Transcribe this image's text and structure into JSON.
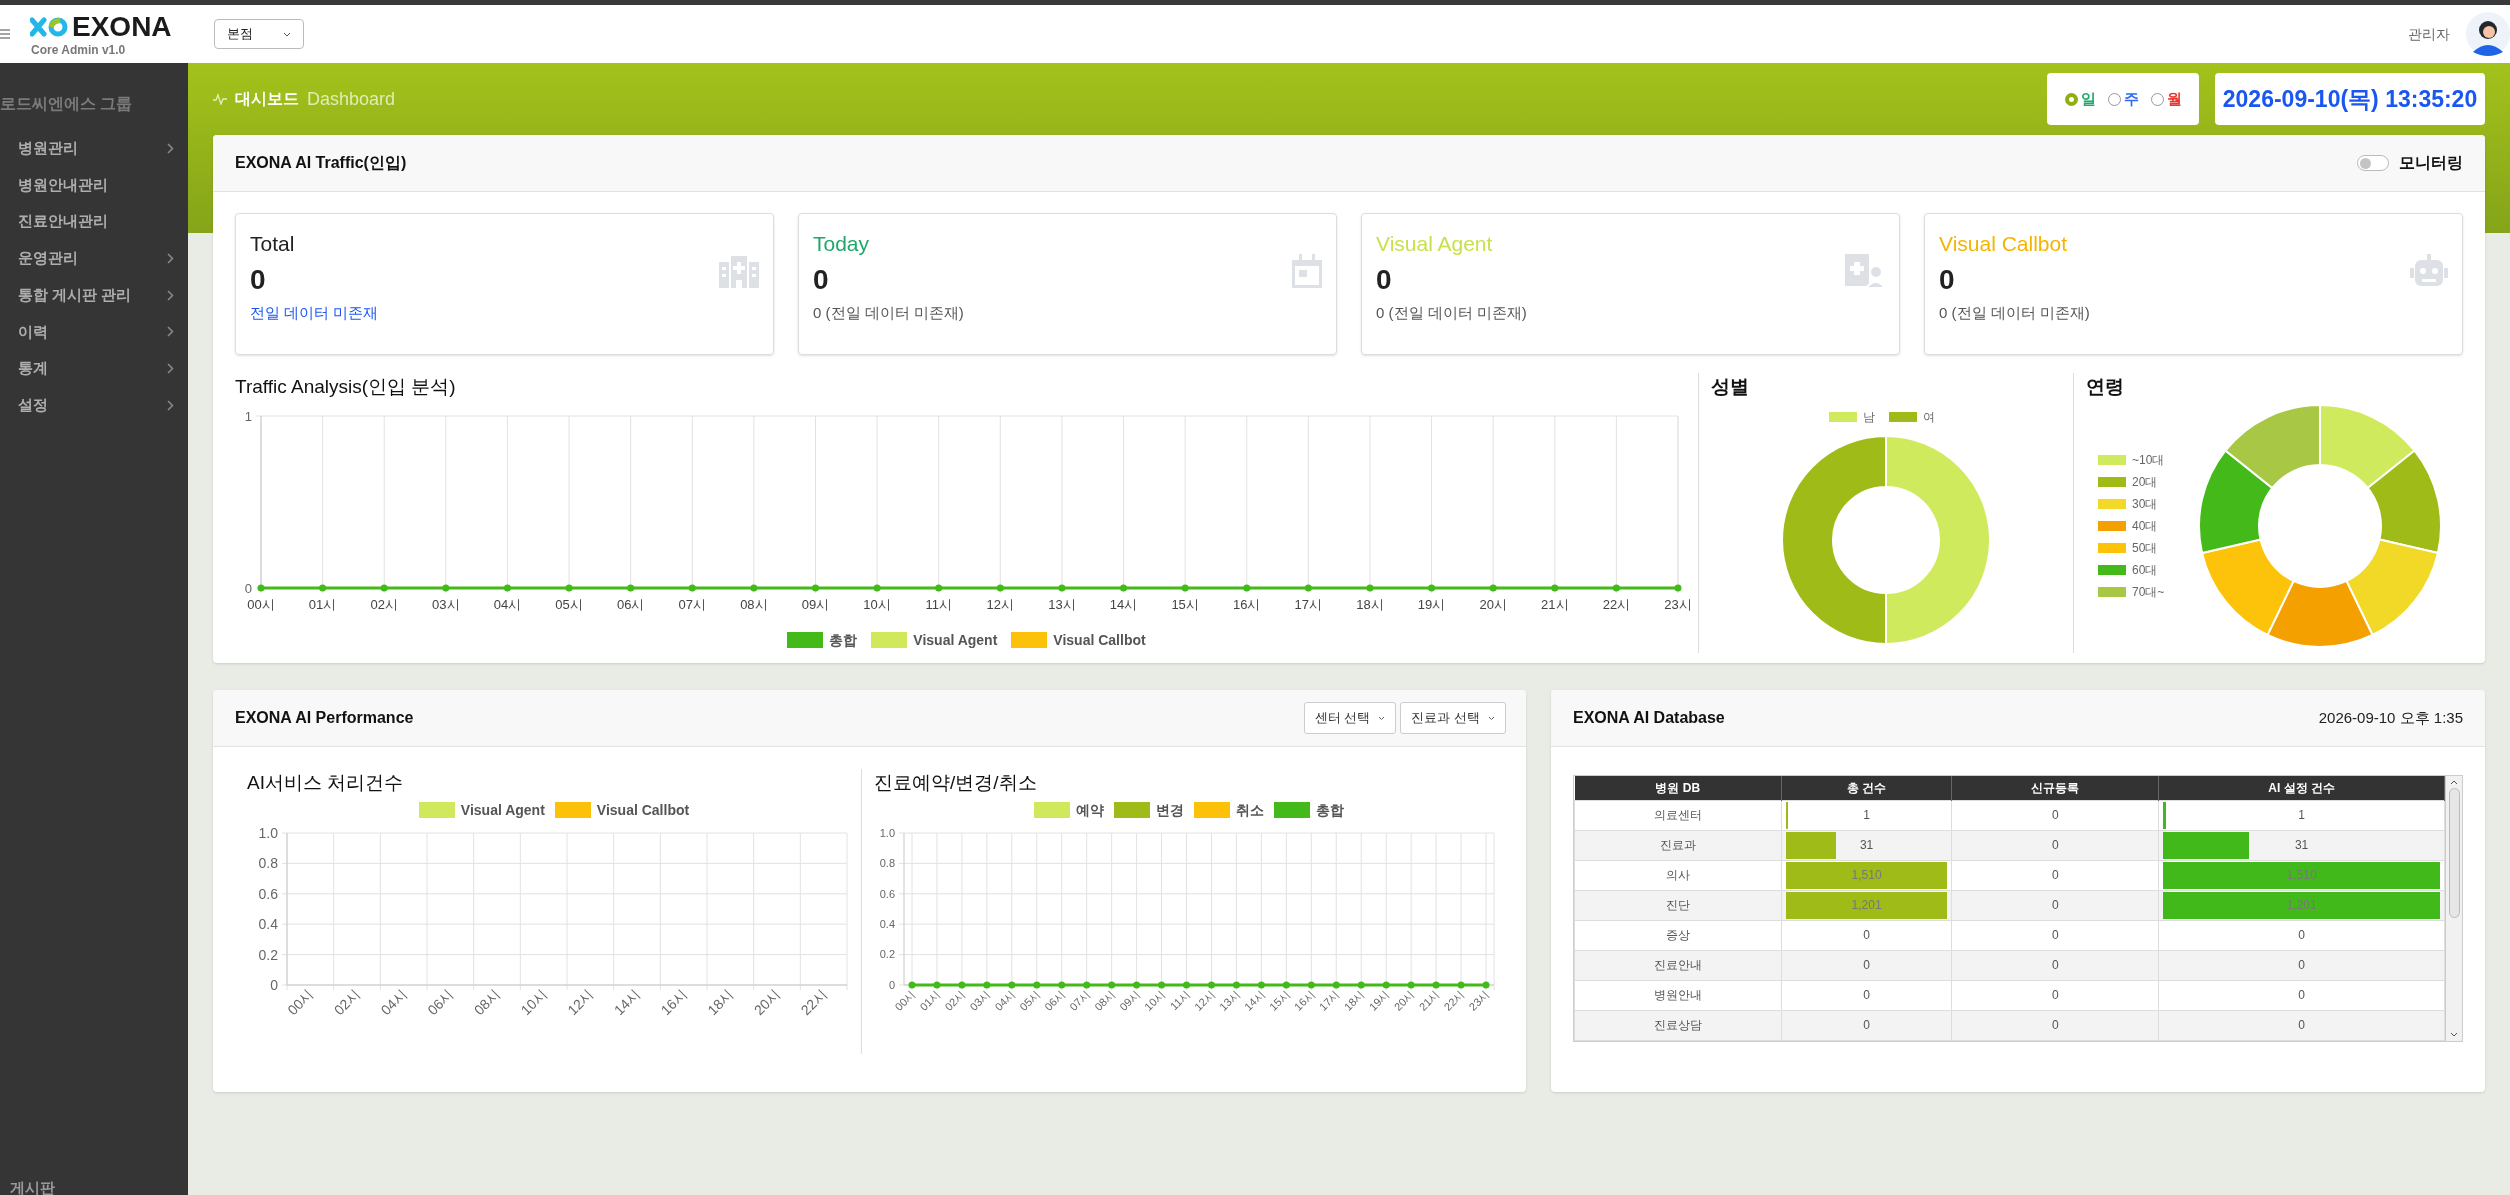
{
  "header": {
    "logo_text": "EXONA",
    "logo_subtitle": "Core Admin v1.0",
    "branch_select": "본점",
    "user_name": "관리자"
  },
  "sidebar": {
    "group_title": "로드씨엔에스 그룹",
    "items": [
      {
        "label": "병원관리",
        "expandable": true
      },
      {
        "label": "병원안내관리",
        "expandable": false
      },
      {
        "label": "진료안내관리",
        "expandable": false
      },
      {
        "label": "운영관리",
        "expandable": true
      },
      {
        "label": "통합 게시판 관리",
        "expandable": true
      },
      {
        "label": "이력",
        "expandable": true
      },
      {
        "label": "통계",
        "expandable": true
      },
      {
        "label": "설정",
        "expandable": true
      }
    ],
    "footer_item": "게시판"
  },
  "breadcrumb": {
    "title": "대시보드",
    "subtitle": "Dashboard"
  },
  "period_options": [
    {
      "label": "일",
      "selected": true,
      "color": "#1ea86a"
    },
    {
      "label": "주",
      "selected": false,
      "color": "#2f6bf5"
    },
    {
      "label": "월",
      "selected": false,
      "color": "#e8382f"
    }
  ],
  "clock": "2026-09-10(목) 13:35:20",
  "traffic_card": {
    "title": "EXONA AI Traffic(인입)",
    "monitoring": {
      "label": "모니터링",
      "on": false
    },
    "stats": [
      {
        "kind": "total",
        "title": "Total",
        "color": "#222222",
        "value": "0",
        "note": "전일 데이터 미존재"
      },
      {
        "kind": "today",
        "title": "Today",
        "color": "#1ea86a",
        "value": "0",
        "note": "0 (전일 데이터 미존재)"
      },
      {
        "kind": "agent",
        "title": "Visual Agent",
        "color": "#c9e04c",
        "value": "0",
        "note": "0 (전일 데이터 미존재)"
      },
      {
        "kind": "callbot",
        "title": "Visual Callbot",
        "color": "#f5b400",
        "value": "0",
        "note": "0 (전일 데이터 미존재)"
      }
    ],
    "traffic_analysis": {
      "title": "Traffic Analysis(인입 분석)",
      "chart_data": {
        "type": "line",
        "categories": [
          "00시",
          "01시",
          "02시",
          "03시",
          "04시",
          "05시",
          "06시",
          "07시",
          "08시",
          "09시",
          "10시",
          "11시",
          "12시",
          "13시",
          "14시",
          "15시",
          "16시",
          "17시",
          "18시",
          "19시",
          "20시",
          "21시",
          "22시",
          "23시"
        ],
        "ylim": [
          0,
          1
        ],
        "yticks": [
          0,
          1
        ],
        "grid": true,
        "series": [
          {
            "name": "총합",
            "color": "#43b91a",
            "marker": true,
            "values": [
              0,
              0,
              0,
              0,
              0,
              0,
              0,
              0,
              0,
              0,
              0,
              0,
              0,
              0,
              0,
              0,
              0,
              0,
              0,
              0,
              0,
              0,
              0,
              0
            ]
          },
          {
            "name": "Visual Agent",
            "color": "#d0e85c",
            "values": [
              null,
              null,
              null,
              null,
              null,
              null,
              null,
              null,
              null,
              null,
              null,
              null,
              null,
              null,
              null,
              null,
              null,
              null,
              null,
              null,
              null,
              null,
              null,
              null
            ]
          },
          {
            "name": "Visual Callbot",
            "color": "#fcc20a",
            "values": [
              null,
              null,
              null,
              null,
              null,
              null,
              null,
              null,
              null,
              null,
              null,
              null,
              null,
              null,
              null,
              null,
              null,
              null,
              null,
              null,
              null,
              null,
              null,
              null
            ]
          }
        ]
      }
    },
    "gender": {
      "title": "성별",
      "legend": [
        {
          "label": "남",
          "color": "#d0ea5e"
        },
        {
          "label": "여",
          "color": "#9fbb17"
        }
      ]
    },
    "age": {
      "title": "연령",
      "legend": [
        {
          "label": "~10대",
          "color": "#d0ea5e"
        },
        {
          "label": "20대",
          "color": "#9fbb17"
        },
        {
          "label": "30대",
          "color": "#f3d927"
        },
        {
          "label": "40대",
          "color": "#f4a000"
        },
        {
          "label": "50대",
          "color": "#fdc30a"
        },
        {
          "label": "60대",
          "color": "#43b91a"
        },
        {
          "label": "70대~",
          "color": "#a8c845"
        }
      ]
    }
  },
  "performance_card": {
    "title": "EXONA AI Performance",
    "filters": [
      "센터 선택",
      "진료과 선택"
    ],
    "service_chart": {
      "title": "AI서비스 처리건수",
      "chart_data": {
        "type": "bar",
        "categories": [
          "00시",
          "02시",
          "04시",
          "06시",
          "08시",
          "10시",
          "12시",
          "14시",
          "16시",
          "18시",
          "20시",
          "22시"
        ],
        "ylim": [
          0,
          1
        ],
        "yticks": [
          0,
          0.2,
          0.4,
          0.6,
          0.8,
          {
            "value": 1,
            "label": "1.0"
          }
        ],
        "grid": true,
        "series": [
          {
            "name": "Visual Agent",
            "color": "#d0e85c",
            "values": [
              0,
              0,
              0,
              0,
              0,
              0,
              0,
              0,
              0,
              0,
              0,
              0
            ]
          },
          {
            "name": "Visual Callbot",
            "color": "#fcc20a",
            "values": [
              0,
              0,
              0,
              0,
              0,
              0,
              0,
              0,
              0,
              0,
              0,
              0
            ]
          }
        ]
      }
    },
    "reservation_chart": {
      "title": "진료예약/변경/취소",
      "chart_data": {
        "type": "line",
        "categories": [
          "00시",
          "01시",
          "02시",
          "03시",
          "04시",
          "05시",
          "06시",
          "07시",
          "08시",
          "09시",
          "10시",
          "11시",
          "12시",
          "13시",
          "14시",
          "15시",
          "16시",
          "17시",
          "18시",
          "19시",
          "20시",
          "21시",
          "22시",
          "23시"
        ],
        "ylim": [
          0,
          1
        ],
        "yticks": [
          0,
          0.2,
          0.4,
          0.6,
          0.8,
          {
            "value": 1,
            "label": "1.0"
          }
        ],
        "grid": true,
        "series": [
          {
            "name": "예약",
            "color": "#d0e85c",
            "values": [
              null,
              null,
              null,
              null,
              null,
              null,
              null,
              null,
              null,
              null,
              null,
              null,
              null,
              null,
              null,
              null,
              null,
              null,
              null,
              null,
              null,
              null,
              null,
              null
            ]
          },
          {
            "name": "변경",
            "color": "#9fbb17",
            "values": [
              null,
              null,
              null,
              null,
              null,
              null,
              null,
              null,
              null,
              null,
              null,
              null,
              null,
              null,
              null,
              null,
              null,
              null,
              null,
              null,
              null,
              null,
              null,
              null
            ]
          },
          {
            "name": "취소",
            "color": "#fcc20a",
            "values": [
              null,
              null,
              null,
              null,
              null,
              null,
              null,
              null,
              null,
              null,
              null,
              null,
              null,
              null,
              null,
              null,
              null,
              null,
              null,
              null,
              null,
              null,
              null,
              null
            ]
          },
          {
            "name": "총합",
            "color": "#43b91a",
            "marker": true,
            "values": [
              0,
              0,
              0,
              0,
              0,
              0,
              0,
              0,
              0,
              0,
              0,
              0,
              0,
              0,
              0,
              0,
              0,
              0,
              0,
              0,
              0,
              0,
              0,
              0
            ]
          }
        ]
      }
    }
  },
  "database_card": {
    "title": "EXONA AI Database",
    "timestamp": "2026-09-10 오후 1:35",
    "columns": [
      {
        "label": "병원 DB"
      },
      {
        "label": "총 건수",
        "color": "#9fbb17"
      },
      {
        "label": "신규등록"
      },
      {
        "label": "AI 설정 건수",
        "color": "#42b91a"
      }
    ],
    "rows": [
      {
        "cells": [
          {
            "text": "의료센터"
          },
          {
            "text": "1",
            "level": 0.01
          },
          {
            "text": "0"
          },
          {
            "text": "1",
            "level": 0.01
          }
        ]
      },
      {
        "cells": [
          {
            "text": "진료과"
          },
          {
            "text": "31",
            "level": 0.31
          },
          {
            "text": "0"
          },
          {
            "text": "31",
            "level": 0.31
          }
        ]
      },
      {
        "cells": [
          {
            "text": "의사"
          },
          {
            "text": "1,510",
            "level": 1
          },
          {
            "text": "0"
          },
          {
            "text": "1,510",
            "level": 1
          }
        ]
      },
      {
        "cells": [
          {
            "text": "진단"
          },
          {
            "text": "1,201",
            "level": 1
          },
          {
            "text": "0"
          },
          {
            "text": "1,201",
            "level": 1
          }
        ]
      },
      {
        "cells": [
          {
            "text": "증상"
          },
          {
            "text": "0"
          },
          {
            "text": "0"
          },
          {
            "text": "0"
          }
        ]
      },
      {
        "cells": [
          {
            "text": "진료안내"
          },
          {
            "text": "0"
          },
          {
            "text": "0"
          },
          {
            "text": "0"
          }
        ]
      },
      {
        "cells": [
          {
            "text": "병원안내"
          },
          {
            "text": "0"
          },
          {
            "text": "0"
          },
          {
            "text": "0"
          }
        ]
      },
      {
        "cells": [
          {
            "text": "진료상담"
          },
          {
            "text": "0"
          },
          {
            "text": "0"
          },
          {
            "text": "0"
          }
        ]
      }
    ]
  }
}
